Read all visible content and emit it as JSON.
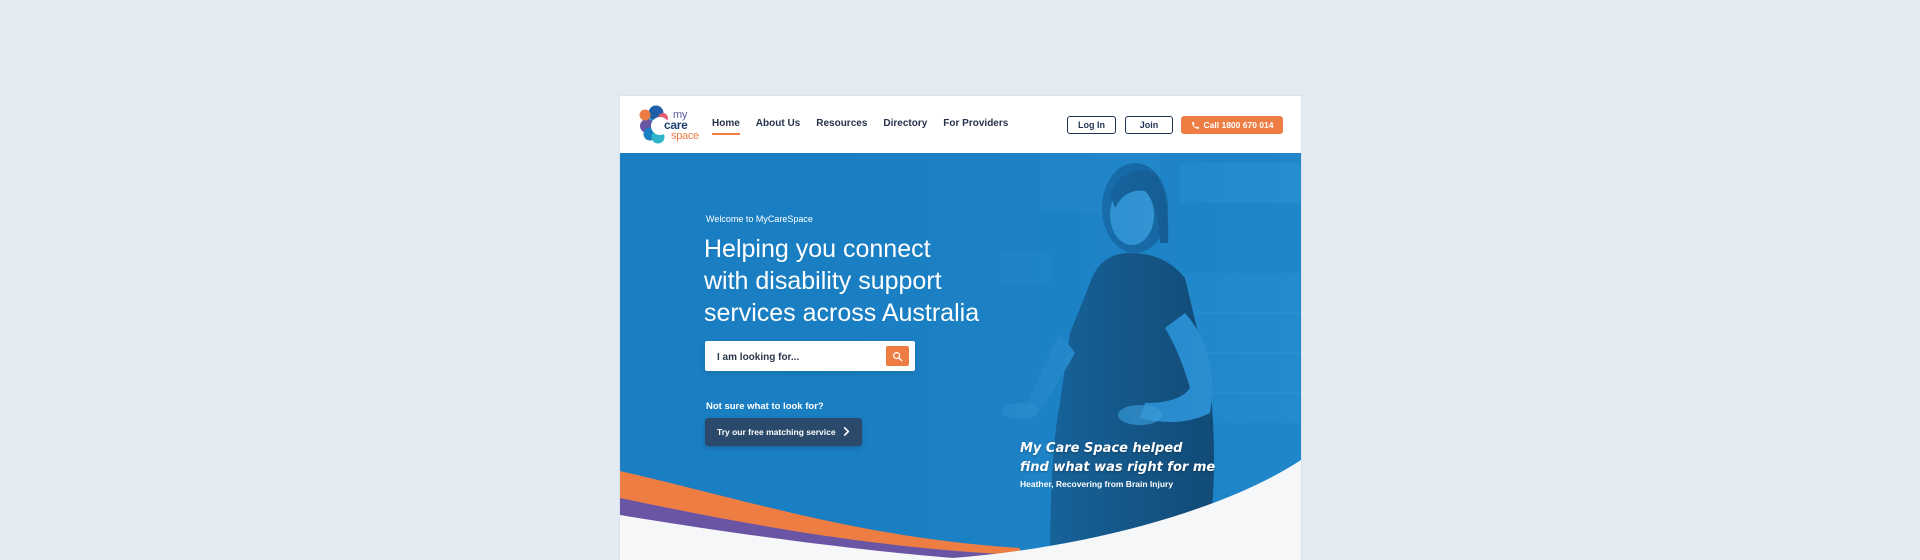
{
  "brand": {
    "logo_alt": "My Care Space",
    "wordmark": [
      "my",
      "care",
      "space"
    ],
    "colors": {
      "orange": "#ee7d44",
      "purple": "#6a55a5",
      "blue": "#1a7ec3",
      "teal": "#2fb4c9",
      "navy": "#1f3350"
    }
  },
  "nav": {
    "items": [
      {
        "label": "Home",
        "active": true
      },
      {
        "label": "About Us",
        "active": false
      },
      {
        "label": "Resources",
        "active": false
      },
      {
        "label": "Directory",
        "active": false
      },
      {
        "label": "For Providers",
        "active": false
      }
    ]
  },
  "header_actions": {
    "login_label": "Log In",
    "join_label": "Join",
    "call_label": "Call 1800 670 014",
    "call_icon": "phone-icon"
  },
  "hero": {
    "eyebrow": "Welcome to MyCareSpace",
    "headline_lines": [
      "Helping you connect",
      "with disability support",
      "services across Australia"
    ],
    "search": {
      "placeholder": "I am looking for...",
      "value": "",
      "icon": "search-icon"
    },
    "not_sure": "Not sure what to look for?",
    "matching_button": "Try our free matching service",
    "matching_icon": "chevron-right-icon",
    "testimonial": {
      "quote_lines": [
        "My Care Space helped",
        "find what was right for me"
      ],
      "attribution": "Heather, Recovering from Brain Injury"
    }
  }
}
